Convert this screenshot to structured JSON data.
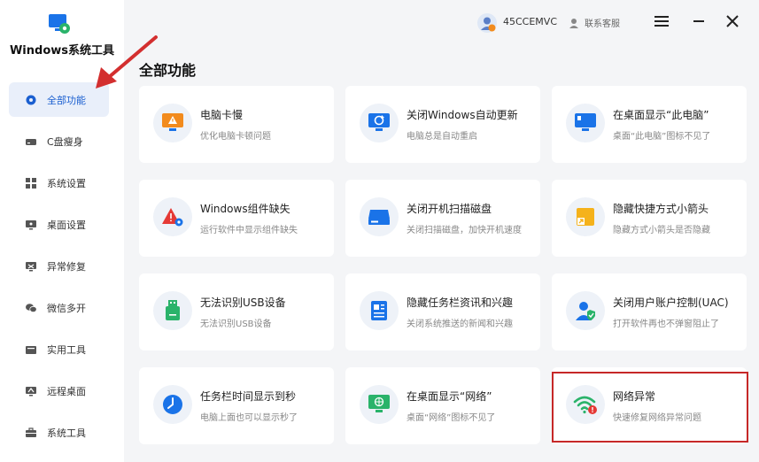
{
  "app": {
    "title": "Windows系统工具"
  },
  "sidebar": {
    "items": [
      {
        "label": "全部功能",
        "icon": "gear-icon",
        "active": true
      },
      {
        "label": "C盘瘦身",
        "icon": "drive-icon"
      },
      {
        "label": "系统设置",
        "icon": "grid-icon"
      },
      {
        "label": "桌面设置",
        "icon": "monitor-icon"
      },
      {
        "label": "异常修复",
        "icon": "wrench-icon"
      },
      {
        "label": "微信多开",
        "icon": "wechat-icon"
      },
      {
        "label": "实用工具",
        "icon": "toolbox-icon"
      },
      {
        "label": "远程桌面",
        "icon": "remote-icon"
      },
      {
        "label": "系统工具",
        "icon": "briefcase-icon"
      }
    ]
  },
  "header": {
    "user": "45CCEMVC",
    "support": "联系客服"
  },
  "main": {
    "section_title": "全部功能",
    "cards": [
      {
        "title": "电脑卡慢",
        "desc": "优化电脑卡顿问题",
        "icon": "warning-monitor-icon"
      },
      {
        "title": "关闭Windows自动更新",
        "desc": "电脑总是自动重启",
        "icon": "update-monitor-icon"
      },
      {
        "title": "在桌面显示“此电脑”",
        "desc": "桌面“此电脑”图标不见了",
        "icon": "this-pc-icon"
      },
      {
        "title": "Windows组件缺失",
        "desc": "运行软件中显示组件缺失",
        "icon": "component-warning-icon"
      },
      {
        "title": "关闭开机扫描磁盘",
        "desc": "关闭扫描磁盘，加快开机速度",
        "icon": "disk-icon"
      },
      {
        "title": "隐藏快捷方式小箭头",
        "desc": "隐藏方式小箭头是否隐藏",
        "icon": "shortcut-arrow-icon"
      },
      {
        "title": "无法识别USB设备",
        "desc": "无法识别USB设备",
        "icon": "usb-icon"
      },
      {
        "title": "隐藏任务栏资讯和兴趣",
        "desc": "关闭系统推送的新闻和兴趣",
        "icon": "news-icon"
      },
      {
        "title": "关闭用户账户控制(UAC)",
        "desc": "打开软件再也不弹窗阻止了",
        "icon": "uac-user-icon"
      },
      {
        "title": "任务栏时间显示到秒",
        "desc": "电脑上面也可以显示秒了",
        "icon": "clock-icon"
      },
      {
        "title": "在桌面显示“网络”",
        "desc": "桌面“网络”图标不见了",
        "icon": "network-monitor-icon"
      },
      {
        "title": "网络异常",
        "desc": "快速修复网络异常问题",
        "icon": "wifi-warning-icon"
      }
    ]
  },
  "colors": {
    "accent": "#1a5fd0",
    "annotation": "#c62828",
    "orange": "#f28b1d"
  }
}
